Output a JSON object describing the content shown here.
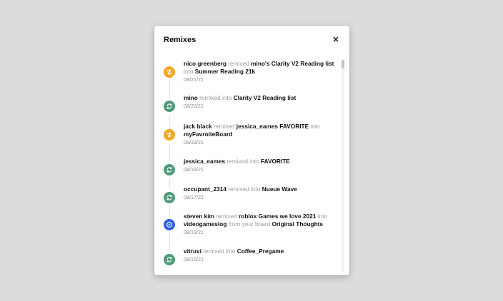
{
  "modal": {
    "title": "Remixes",
    "close_label": "×"
  },
  "colors": {
    "remix_icon": "#f2a81d",
    "green_icon": "#4d9a78",
    "blue_icon": "#2f5fe0"
  },
  "activities": [
    {
      "icon": "shuffle-icon",
      "color": "#f2a81d",
      "parts": [
        {
          "t": "nico greenberg",
          "s": "strong"
        },
        {
          "t": " remixed ",
          "s": "muted"
        },
        {
          "t": "mino's Clarity V2 Reading list",
          "s": "strong"
        },
        {
          "t": " into ",
          "s": "muted"
        },
        {
          "t": "Summer Reading 21k",
          "s": "strong"
        }
      ],
      "date": "08/21/21"
    },
    {
      "icon": "sync-icon",
      "color": "#4d9a78",
      "parts": [
        {
          "t": "mino",
          "s": "strong"
        },
        {
          "t": " remixed into ",
          "s": "muted"
        },
        {
          "t": "Clarity V2 Reading list",
          "s": "strong"
        }
      ],
      "date": "08/20/21"
    },
    {
      "icon": "shuffle-icon",
      "color": "#f2a81d",
      "parts": [
        {
          "t": "jack black",
          "s": "strong"
        },
        {
          "t": " remixed ",
          "s": "muted"
        },
        {
          "t": "jessica_eames FAVORITE",
          "s": "strong"
        },
        {
          "t": " into ",
          "s": "muted"
        },
        {
          "t": "myFavroiteBoard",
          "s": "strong"
        }
      ],
      "date": "08/19/21"
    },
    {
      "icon": "sync-icon",
      "color": "#4d9a78",
      "parts": [
        {
          "t": "jessica_eames",
          "s": "strong"
        },
        {
          "t": " remixed into ",
          "s": "muted"
        },
        {
          "t": "FAVORITE",
          "s": "strong"
        }
      ],
      "date": "08/18/21"
    },
    {
      "icon": "sync-icon",
      "color": "#4d9a78",
      "parts": [
        {
          "t": "occupant_2314",
          "s": "strong"
        },
        {
          "t": " remixed into ",
          "s": "muted"
        },
        {
          "t": "Nueue Wave",
          "s": "strong"
        }
      ],
      "date": "08/17/21"
    },
    {
      "icon": "compass-icon",
      "color": "#2f5fe0",
      "parts": [
        {
          "t": "steven kim",
          "s": "strong"
        },
        {
          "t": " remixed ",
          "s": "muted"
        },
        {
          "t": "roblox Games we love 2021",
          "s": "strong"
        },
        {
          "t": " into ",
          "s": "muted"
        },
        {
          "t": "videogameslog",
          "s": "strong"
        },
        {
          "t": " from your board ",
          "s": "muted"
        },
        {
          "t": "Original Thoughts",
          "s": "strong"
        }
      ],
      "date": "08/19/21"
    },
    {
      "icon": "sync-icon",
      "color": "#4d9a78",
      "parts": [
        {
          "t": "vitruvi",
          "s": "strong"
        },
        {
          "t": " remixed into ",
          "s": "muted"
        },
        {
          "t": "Coffee_Pregame",
          "s": "strong"
        }
      ],
      "date": "08/16/21"
    }
  ]
}
